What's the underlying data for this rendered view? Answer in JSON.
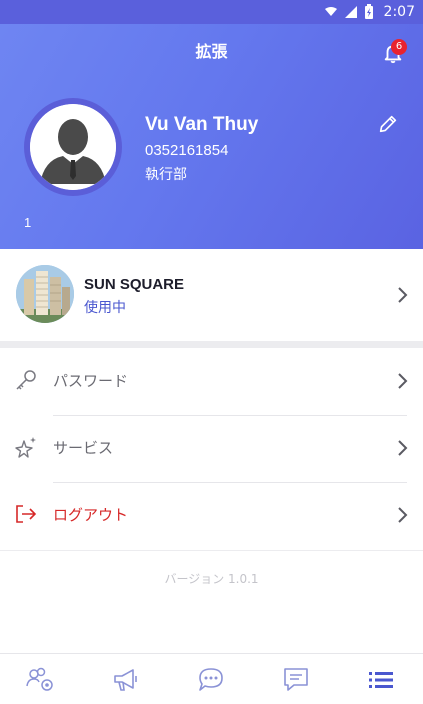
{
  "status_bar": {
    "time": "2:07"
  },
  "header": {
    "title": "拡張",
    "notification_count": "6"
  },
  "profile": {
    "name": "Vu Van Thuy",
    "phone": "0352161854",
    "department": "執行部",
    "extra": "1"
  },
  "project": {
    "name": "SUN SQUARE",
    "status": "使用中"
  },
  "menu": [
    {
      "label": "パスワード",
      "icon": "key-icon"
    },
    {
      "label": "サービス",
      "icon": "sparkle-star-icon"
    },
    {
      "label": "ログアウト",
      "icon": "logout-icon"
    }
  ],
  "version": "バージョン 1.0.1",
  "bottom_nav": [
    {
      "icon": "users-settings-icon",
      "active": false
    },
    {
      "icon": "megaphone-icon",
      "active": false
    },
    {
      "icon": "chat-bubble-icon",
      "active": false
    },
    {
      "icon": "message-square-icon",
      "active": false
    },
    {
      "icon": "list-icon",
      "active": true
    }
  ],
  "colors": {
    "accent": "#4a57cf",
    "header_start": "#6f86f2",
    "header_end": "#5a63e2",
    "logout": "#d62828",
    "badge": "#e8232f",
    "inactive_icon": "#8a92d6"
  }
}
